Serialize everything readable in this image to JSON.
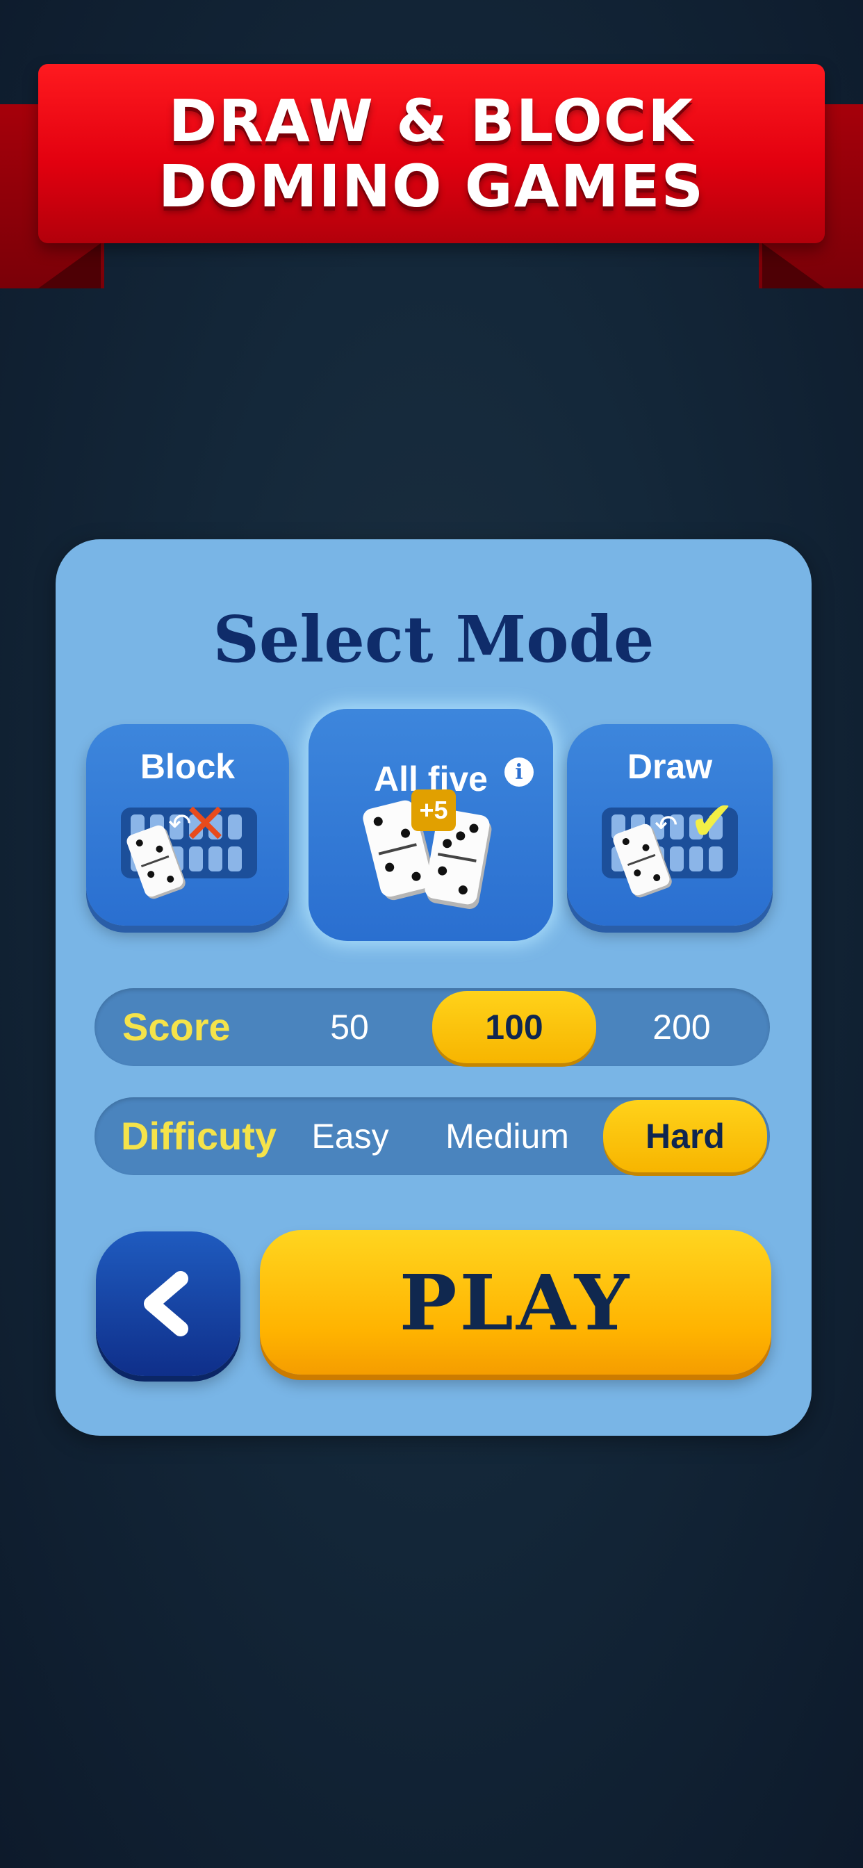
{
  "banner": {
    "line1": "DRAW & BLOCK",
    "line2": "DOMINO GAMES"
  },
  "panel": {
    "title": "Select Mode",
    "modes": [
      {
        "label": "Block",
        "icon": "block-cross-icon",
        "selected": false
      },
      {
        "label": "All five",
        "badge": "+5",
        "info_icon": "i",
        "selected": true
      },
      {
        "label": "Draw",
        "icon": "draw-check-icon",
        "selected": false
      }
    ],
    "score": {
      "label": "Score",
      "options": [
        "50",
        "100",
        "200"
      ],
      "selected": "100"
    },
    "difficulty": {
      "label": "Difficuty",
      "options": [
        "Easy",
        "Medium",
        "Hard"
      ],
      "selected": "Hard"
    },
    "play_label": "PLAY",
    "back_icon": "chevron-left-icon"
  },
  "colors": {
    "banner_red": "#e2000f",
    "panel_blue": "#79b5e6",
    "mode_blue": "#2a6fd0",
    "accent_yellow": "#ffb300",
    "label_yellow": "#f5e34a",
    "title_navy": "#0f2c6a"
  }
}
